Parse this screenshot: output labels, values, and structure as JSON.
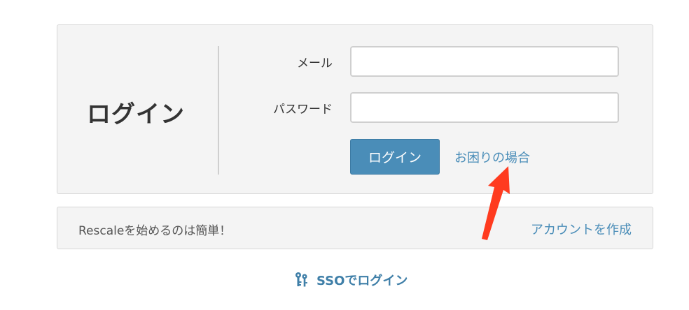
{
  "login": {
    "title": "ログイン",
    "email_label": "メール",
    "email_value": "",
    "password_label": "パスワード",
    "password_value": "",
    "submit_label": "ログイン",
    "help_link": "お困りの場合"
  },
  "signup": {
    "text": "Rescaleを始めるのは簡単！",
    "create_link": "アカウントを作成"
  },
  "sso": {
    "label": "SSOでログイン",
    "icon": "keys-icon"
  },
  "colors": {
    "accent": "#4a8db8",
    "panel_bg": "#f4f4f4",
    "annotation": "#ff3b1f"
  }
}
